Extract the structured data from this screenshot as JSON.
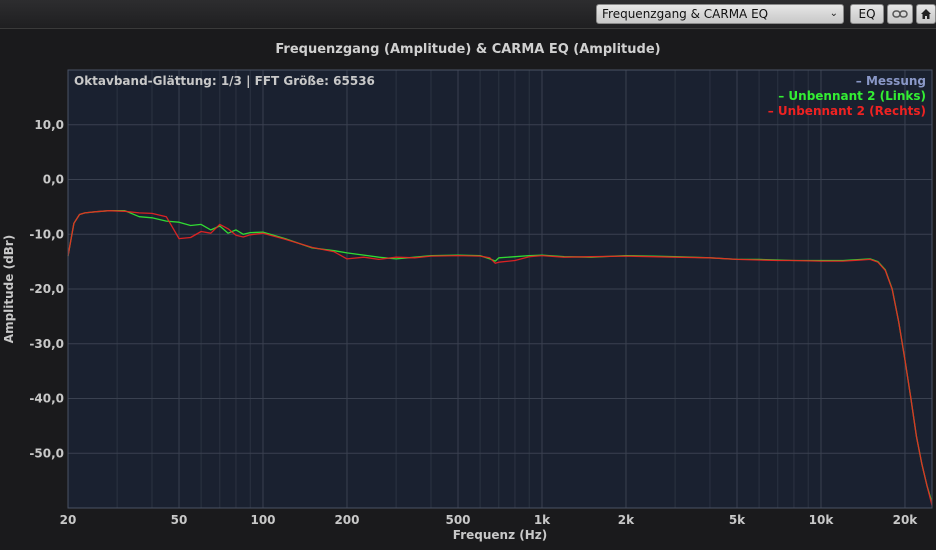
{
  "toolbar": {
    "dropdown_value": "Frequenzgang & CARMA EQ",
    "eq_label": "EQ",
    "link_icon": "link-icon",
    "home_icon": "home-icon"
  },
  "colors": {
    "background": "#1a1a1c",
    "plot_bg": "#1a2130",
    "grid": "#3a4150",
    "measure": "#8a98c8",
    "left": "#33ee33",
    "right": "#ee2222",
    "text": "#c8c8c8"
  },
  "chart_data": {
    "type": "line",
    "title": "Frequenzgang (Amplitude) & CARMA EQ (Amplitude)",
    "info": "Oktavband-Glättung: 1/3 | FFT Größe: 65536",
    "xlabel": "Frequenz (Hz)",
    "ylabel": "Amplitude (dBr)",
    "x_scale": "log",
    "xlim": [
      20,
      25000
    ],
    "ylim": [
      -60,
      20
    ],
    "xticks": [
      {
        "value": 20,
        "label": "20"
      },
      {
        "value": 50,
        "label": "50"
      },
      {
        "value": 100,
        "label": "100"
      },
      {
        "value": 200,
        "label": "200"
      },
      {
        "value": 500,
        "label": "500"
      },
      {
        "value": 1000,
        "label": "1k"
      },
      {
        "value": 2000,
        "label": "2k"
      },
      {
        "value": 5000,
        "label": "5k"
      },
      {
        "value": 10000,
        "label": "10k"
      },
      {
        "value": 20000,
        "label": "20k"
      }
    ],
    "yticks": [
      {
        "value": 10,
        "label": "10,0"
      },
      {
        "value": 0,
        "label": "0,0"
      },
      {
        "value": -10,
        "label": "-10,0"
      },
      {
        "value": -20,
        "label": "-20,0"
      },
      {
        "value": -30,
        "label": "-30,0"
      },
      {
        "value": -40,
        "label": "-40,0"
      },
      {
        "value": -50,
        "label": "-50,0"
      }
    ],
    "grid": true,
    "legend_position": "top-right",
    "legend": [
      {
        "name": "Messung",
        "color": "#8a98c8"
      },
      {
        "name": "Unbennant 2 (Links)",
        "color": "#33ee33"
      },
      {
        "name": "Unbennant 2 (Rechts)",
        "color": "#ee2222"
      }
    ],
    "series": [
      {
        "name": "Unbennant 2 (Links)",
        "color": "#33ee33",
        "x": [
          20,
          21,
          22,
          23,
          25,
          28,
          32,
          36,
          40,
          45,
          50,
          55,
          60,
          65,
          70,
          75,
          80,
          85,
          90,
          100,
          120,
          150,
          180,
          200,
          230,
          260,
          300,
          350,
          400,
          500,
          600,
          650,
          680,
          700,
          800,
          900,
          1000,
          1200,
          1500,
          2000,
          2500,
          3000,
          4000,
          5000,
          6000,
          7000,
          8000,
          10000,
          12000,
          14000,
          15000,
          16000,
          17000,
          18000,
          19000,
          20000,
          21000,
          22000,
          23000,
          24000,
          25000
        ],
        "y": [
          -14,
          -8,
          -6.4,
          -6.1,
          -5.9,
          -5.7,
          -5.7,
          -6.8,
          -7,
          -7.6,
          -7.8,
          -8.4,
          -8.2,
          -9.2,
          -8.5,
          -9.8,
          -9.2,
          -10,
          -9.7,
          -9.6,
          -10.8,
          -12.5,
          -13,
          -13.4,
          -13.8,
          -14.2,
          -14.5,
          -14.2,
          -13.9,
          -13.8,
          -13.9,
          -14.5,
          -14.9,
          -14.3,
          -14.1,
          -13.9,
          -13.8,
          -14.1,
          -14.2,
          -13.9,
          -14,
          -14.1,
          -14.3,
          -14.6,
          -14.6,
          -14.7,
          -14.8,
          -14.8,
          -14.8,
          -14.6,
          -14.5,
          -15,
          -16.5,
          -20,
          -26,
          -33,
          -40,
          -47,
          -52,
          -56,
          -59
        ]
      },
      {
        "name": "Unbennant 2 (Rechts)",
        "color": "#ee2222",
        "x": [
          20,
          21,
          22,
          23,
          25,
          28,
          32,
          36,
          40,
          45,
          50,
          55,
          60,
          65,
          70,
          75,
          80,
          85,
          90,
          100,
          120,
          150,
          180,
          200,
          230,
          260,
          300,
          350,
          400,
          500,
          600,
          650,
          680,
          700,
          800,
          900,
          1000,
          1200,
          1500,
          2000,
          2500,
          3000,
          4000,
          5000,
          6000,
          7000,
          8000,
          10000,
          12000,
          14000,
          15000,
          16000,
          17000,
          18000,
          19000,
          20000,
          21000,
          22000,
          23000,
          24000,
          25000
        ],
        "y": [
          -14,
          -8,
          -6.4,
          -6.1,
          -5.9,
          -5.7,
          -5.8,
          -6.1,
          -6.2,
          -6.8,
          -10.8,
          -10.6,
          -9.5,
          -9.8,
          -8.2,
          -9,
          -10.2,
          -10.5,
          -10.1,
          -9.8,
          -10.9,
          -12.4,
          -13.2,
          -14.5,
          -14.2,
          -14.6,
          -14.2,
          -14.3,
          -14,
          -13.9,
          -14,
          -14.3,
          -15.3,
          -15.1,
          -14.8,
          -14.1,
          -13.9,
          -14.2,
          -14.1,
          -14,
          -14.1,
          -14.2,
          -14.3,
          -14.6,
          -14.7,
          -14.8,
          -14.8,
          -14.9,
          -14.9,
          -14.7,
          -14.6,
          -15.1,
          -16.6,
          -20.1,
          -26,
          -33,
          -40,
          -47,
          -52,
          -56,
          -59.5
        ]
      }
    ]
  }
}
